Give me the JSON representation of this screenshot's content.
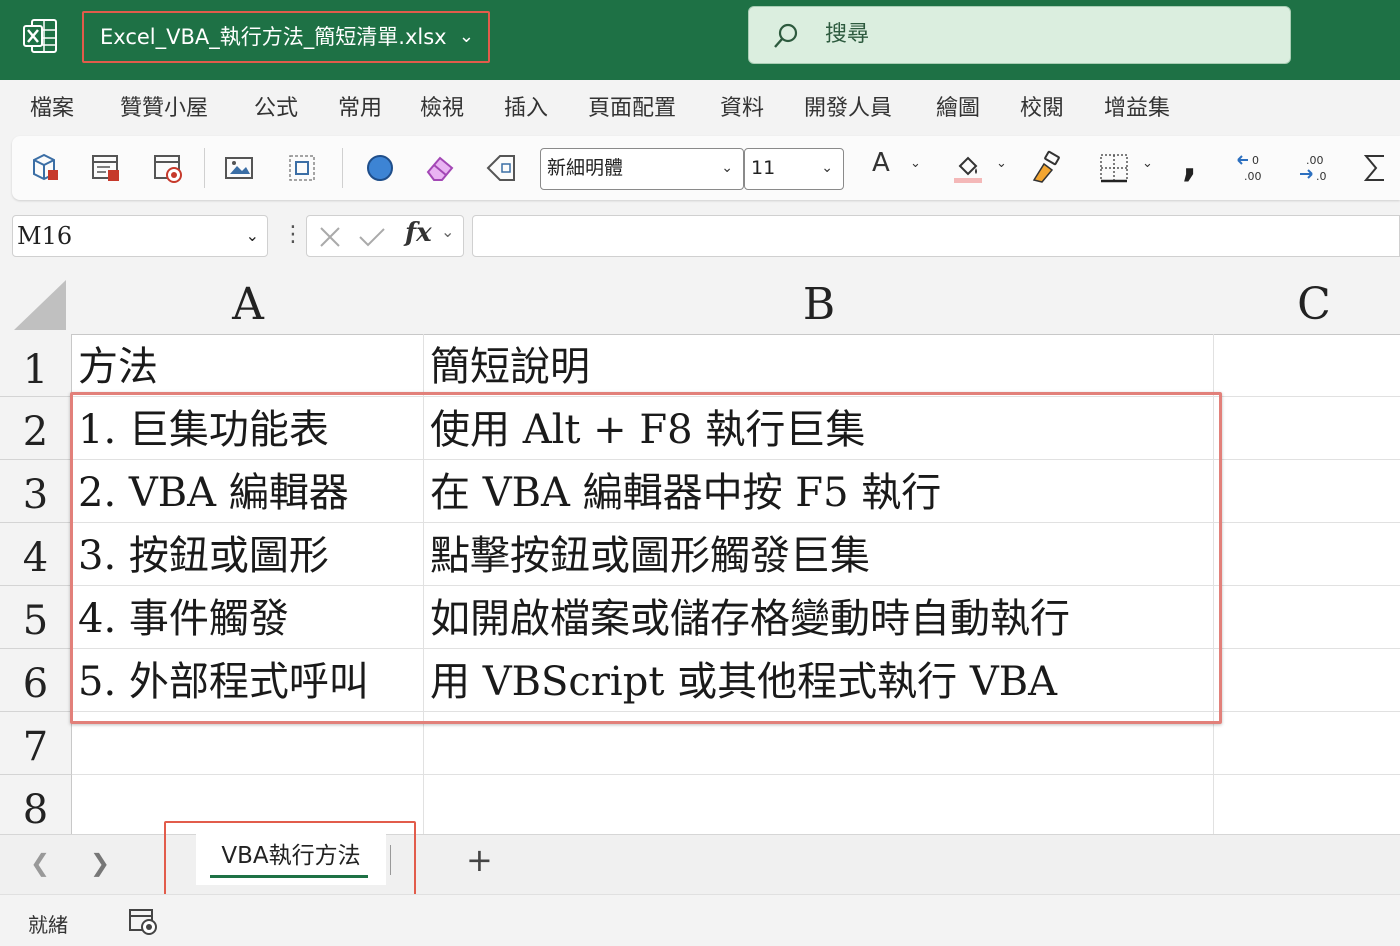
{
  "title_bar": {
    "file_name": "Excel_VBA_執行方法_簡短清單.xlsx",
    "search_placeholder": "搜尋",
    "colors": {
      "excel_green": "#1e7145",
      "highlight_red": "#e25c4b"
    }
  },
  "menu": {
    "items": [
      "檔案",
      "贊贊小屋",
      "公式",
      "常用",
      "檢視",
      "插入",
      "頁面配置",
      "資料",
      "開發人員",
      "繪圖",
      "校閱",
      "增益集"
    ]
  },
  "ribbon": {
    "font_name": "新細明體",
    "font_size": "11",
    "icons": [
      "3d-models-icon",
      "record-macro-icon",
      "macro-security-icon",
      "shapes-icon",
      "select-objects-icon",
      "circle-shape-icon",
      "eraser-icon",
      "tag-icon",
      "font-color-icon",
      "fill-color-icon",
      "format-painter-icon",
      "borders-icon",
      "comma-style-icon",
      "decrease-decimal-icon",
      "increase-decimal-icon",
      "autosum-icon"
    ],
    "font_color_label": "A",
    "comma_label": ","
  },
  "formula_bar": {
    "name_box": "M16",
    "fx_label": "fx",
    "formula": ""
  },
  "sheet": {
    "columns": [
      "A",
      "B",
      "C"
    ],
    "rows": [
      {
        "num": "1",
        "a": "方法",
        "b": "簡短說明"
      },
      {
        "num": "2",
        "a": "1. 巨集功能表",
        "b": "使用 Alt + F8 執行巨集"
      },
      {
        "num": "3",
        "a": "2. VBA 編輯器",
        "b": "在 VBA 編輯器中按 F5 執行"
      },
      {
        "num": "4",
        "a": "3. 按鈕或圖形",
        "b": "點擊按鈕或圖形觸發巨集"
      },
      {
        "num": "5",
        "a": "4. 事件觸發",
        "b": "如開啟檔案或儲存格變動時自動執行"
      },
      {
        "num": "6",
        "a": "5. 外部程式呼叫",
        "b": "用 VBScript 或其他程式執行 VBA"
      },
      {
        "num": "7",
        "a": "",
        "b": ""
      },
      {
        "num": "8",
        "a": "",
        "b": ""
      }
    ]
  },
  "sheet_tabs": {
    "active_tab": "VBA執行方法",
    "add_label": "+"
  },
  "status_bar": {
    "status": "就緒"
  }
}
